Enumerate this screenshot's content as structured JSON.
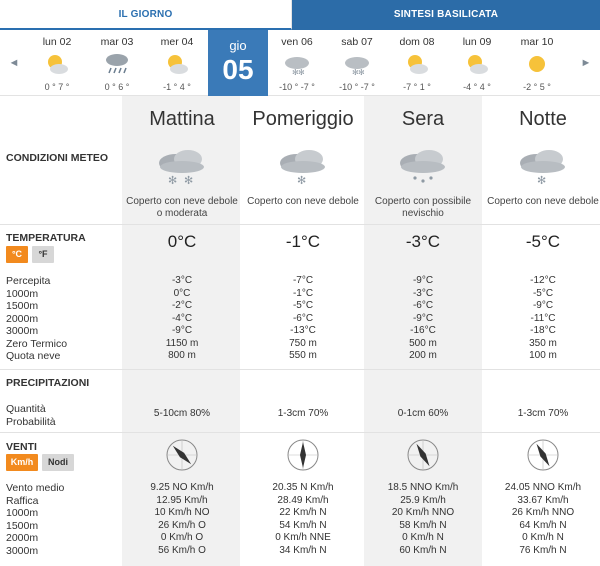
{
  "tabs": {
    "today": "IL GIORNO",
    "summary": "SINTESI BASILICATA"
  },
  "nav": {
    "prev_glyph": "◄",
    "next_glyph": "►"
  },
  "days": [
    {
      "name": "lun 02",
      "temps": "0 ° 7 °",
      "icon": "sun-cloud-icon"
    },
    {
      "name": "mar 03",
      "temps": "0 ° 6 °",
      "icon": "rain-cloud-icon"
    },
    {
      "name": "mer 04",
      "temps": "-1 ° 4 °",
      "icon": "sun-cloud-icon"
    },
    {
      "name": "gio",
      "number": "05",
      "selected": true
    },
    {
      "name": "ven 06",
      "temps": "-10 ° -7 °",
      "icon": "snow-cloud-icon"
    },
    {
      "name": "sab 07",
      "temps": "-10 ° -7 °",
      "icon": "snow-cloud-icon"
    },
    {
      "name": "dom 08",
      "temps": "-7 ° 1 °",
      "icon": "sun-cloud-icon"
    },
    {
      "name": "lun 09",
      "temps": "-4 ° 4 °",
      "icon": "sun-cloud-icon"
    },
    {
      "name": "mar 10",
      "temps": "-2 ° 5 °",
      "icon": "sun-icon"
    }
  ],
  "periods": [
    "Mattina",
    "Pomeriggio",
    "Sera",
    "Notte"
  ],
  "conditions": {
    "title": "CONDIZIONI METEO",
    "values": [
      "Coperto con neve debole o moderata",
      "Coperto con neve debole",
      "Coperto con possibile nevischio",
      "Coperto con neve debole"
    ]
  },
  "temperature": {
    "title": "TEMPERATURA",
    "unit_c": "°C",
    "unit_f": "°F",
    "main": [
      "0°C",
      "-1°C",
      "-3°C",
      "-5°C"
    ],
    "labels": [
      "Percepita",
      "1000m",
      "1500m",
      "2000m",
      "3000m",
      "Zero Termico",
      "Quota neve"
    ],
    "rows": [
      [
        "-3°C",
        "0°C",
        "-2°C",
        "-4°C",
        "-9°C",
        "1150 m",
        "800 m"
      ],
      [
        "-7°C",
        "-1°C",
        "-5°C",
        "-6°C",
        "-13°C",
        "750 m",
        "550 m"
      ],
      [
        "-9°C",
        "-3°C",
        "-6°C",
        "-9°C",
        "-16°C",
        "500 m",
        "200 m"
      ],
      [
        "-12°C",
        "-5°C",
        "-9°C",
        "-11°C",
        "-18°C",
        "350 m",
        "100 m"
      ]
    ]
  },
  "precipitation": {
    "title": "PRECIPITAZIONI",
    "labels": [
      "Quantità",
      "Probabilità"
    ],
    "values": [
      "5-10cm 80%",
      "1-3cm 70%",
      "0-1cm 60%",
      "1-3cm 70%"
    ]
  },
  "wind": {
    "title": "VENTI",
    "unit_kmh": "Km/h",
    "unit_knots": "Nodi",
    "directions_deg": [
      135,
      0,
      330,
      330
    ],
    "labels": [
      "Vento medio",
      "Raffica",
      "1000m",
      "1500m",
      "2000m",
      "3000m"
    ],
    "rows": [
      [
        "9.25 NO Km/h",
        "12.95 Km/h",
        "10 Km/h NO",
        "26 Km/h O",
        "0 Km/h O",
        "56 Km/h O"
      ],
      [
        "20.35 N Km/h",
        "28.49 Km/h",
        "22 Km/h N",
        "54 Km/h N",
        "0 Km/h NNE",
        "34 Km/h N"
      ],
      [
        "18.5 NNO Km/h",
        "25.9 Km/h",
        "20 Km/h NNO",
        "58 Km/h N",
        "0 Km/h N",
        "60 Km/h N"
      ],
      [
        "24.05 NNO Km/h",
        "33.67 Km/h",
        "26 Km/h NNO",
        "64 Km/h N",
        "0 Km/h N",
        "76 Km/h N"
      ]
    ]
  },
  "colors": {
    "tab_blue": "#2c6ca8",
    "selected_day": "#3a7ab8",
    "unit_active": "#f28a1e",
    "column_shade": "#f1f1f1"
  }
}
